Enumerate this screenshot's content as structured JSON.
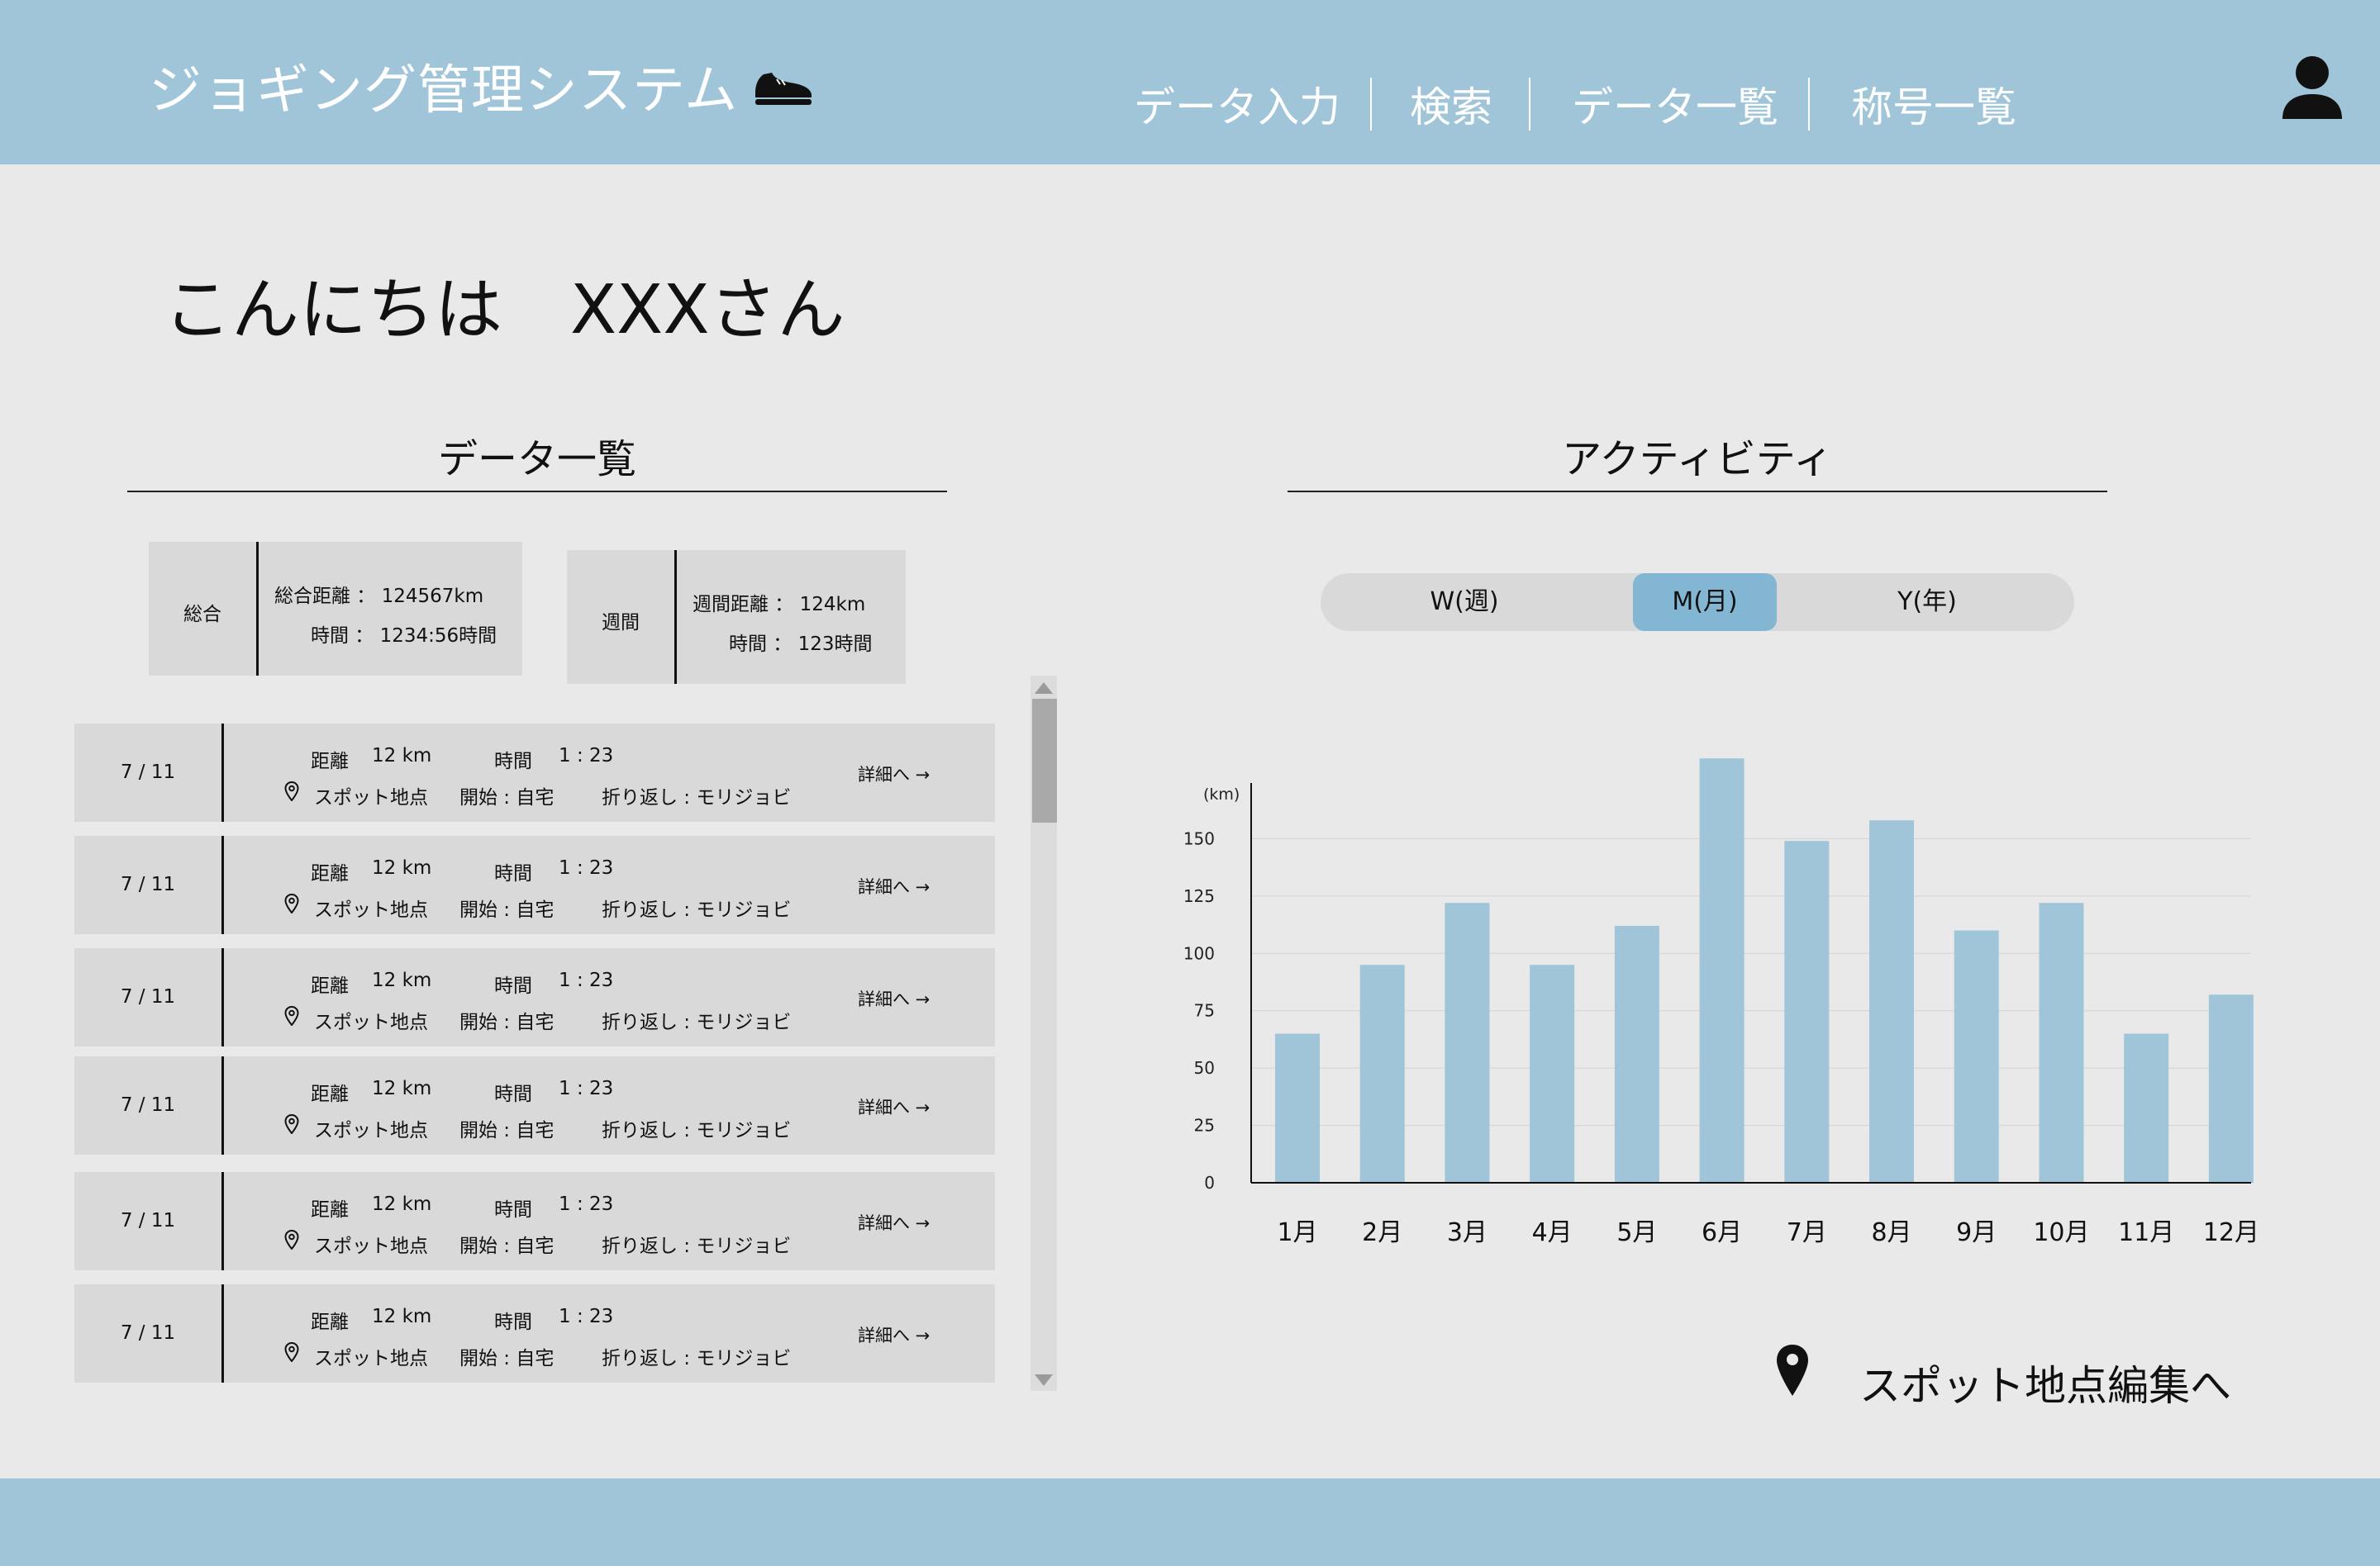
{
  "header": {
    "title": "ジョギング管理システム",
    "nav": [
      "データ入力",
      "検索",
      "データ一覧",
      "称号一覧"
    ]
  },
  "greeting": "こんにちは　XXXさん",
  "data_list": {
    "title": "データ一覧",
    "summary_total": {
      "label": "総合",
      "line1": "総合距離 ： 124567km",
      "line2": "時間 ： 1234:56時間"
    },
    "summary_week": {
      "label": "週間",
      "line1": "週間距離 ： 124km",
      "line2": "時間 ： 123時間"
    },
    "rows": [
      {
        "date": "7 / 11",
        "distance_label": "距離",
        "distance": "12 km",
        "time_label": "時間",
        "time": "1 : 23",
        "spot": "スポット地点",
        "start": "開始 : 自宅",
        "turn": "折り返し : モリジョビ",
        "detail": "詳細へ →"
      },
      {
        "date": "7 / 11",
        "distance_label": "距離",
        "distance": "12 km",
        "time_label": "時間",
        "time": "1 : 23",
        "spot": "スポット地点",
        "start": "開始 : 自宅",
        "turn": "折り返し : モリジョビ",
        "detail": "詳細へ →"
      },
      {
        "date": "7 / 11",
        "distance_label": "距離",
        "distance": "12 km",
        "time_label": "時間",
        "time": "1 : 23",
        "spot": "スポット地点",
        "start": "開始 : 自宅",
        "turn": "折り返し : モリジョビ",
        "detail": "詳細へ →"
      },
      {
        "date": "7 / 11",
        "distance_label": "距離",
        "distance": "12 km",
        "time_label": "時間",
        "time": "1 : 23",
        "spot": "スポット地点",
        "start": "開始 : 自宅",
        "turn": "折り返し : モリジョビ",
        "detail": "詳細へ →"
      },
      {
        "date": "7 / 11",
        "distance_label": "距離",
        "distance": "12 km",
        "time_label": "時間",
        "time": "1 : 23",
        "spot": "スポット地点",
        "start": "開始 : 自宅",
        "turn": "折り返し : モリジョビ",
        "detail": "詳細へ →"
      },
      {
        "date": "7 / 11",
        "distance_label": "距離",
        "distance": "12 km",
        "time_label": "時間",
        "time": "1 : 23",
        "spot": "スポット地点",
        "start": "開始 : 自宅",
        "turn": "折り返し : モリジョビ",
        "detail": "詳細へ →"
      }
    ]
  },
  "activity": {
    "title": "アクティビティ",
    "toggle": [
      "W(週)",
      "M(月)",
      "Y(年)"
    ],
    "selected": "M(月)"
  },
  "chart_data": {
    "type": "bar",
    "categories": [
      "1月",
      "2月",
      "3月",
      "4月",
      "5月",
      "6月",
      "7月",
      "8月",
      "9月",
      "10月",
      "11月",
      "12月"
    ],
    "values": [
      65,
      95,
      122,
      95,
      112,
      185,
      149,
      158,
      110,
      122,
      65,
      82
    ],
    "ylabel": "(km)",
    "yticks": [
      0,
      25,
      50,
      75,
      100,
      125,
      150
    ],
    "ylim": [
      0,
      175
    ],
    "grid": true,
    "color": "#a0c5d9"
  },
  "spot_link": "スポット地点編集へ",
  "colors": {
    "header": "#a0c5d9",
    "background": "#e9e9e9",
    "card": "#d9d9d9",
    "toggle_selected": "#82b6d2"
  }
}
